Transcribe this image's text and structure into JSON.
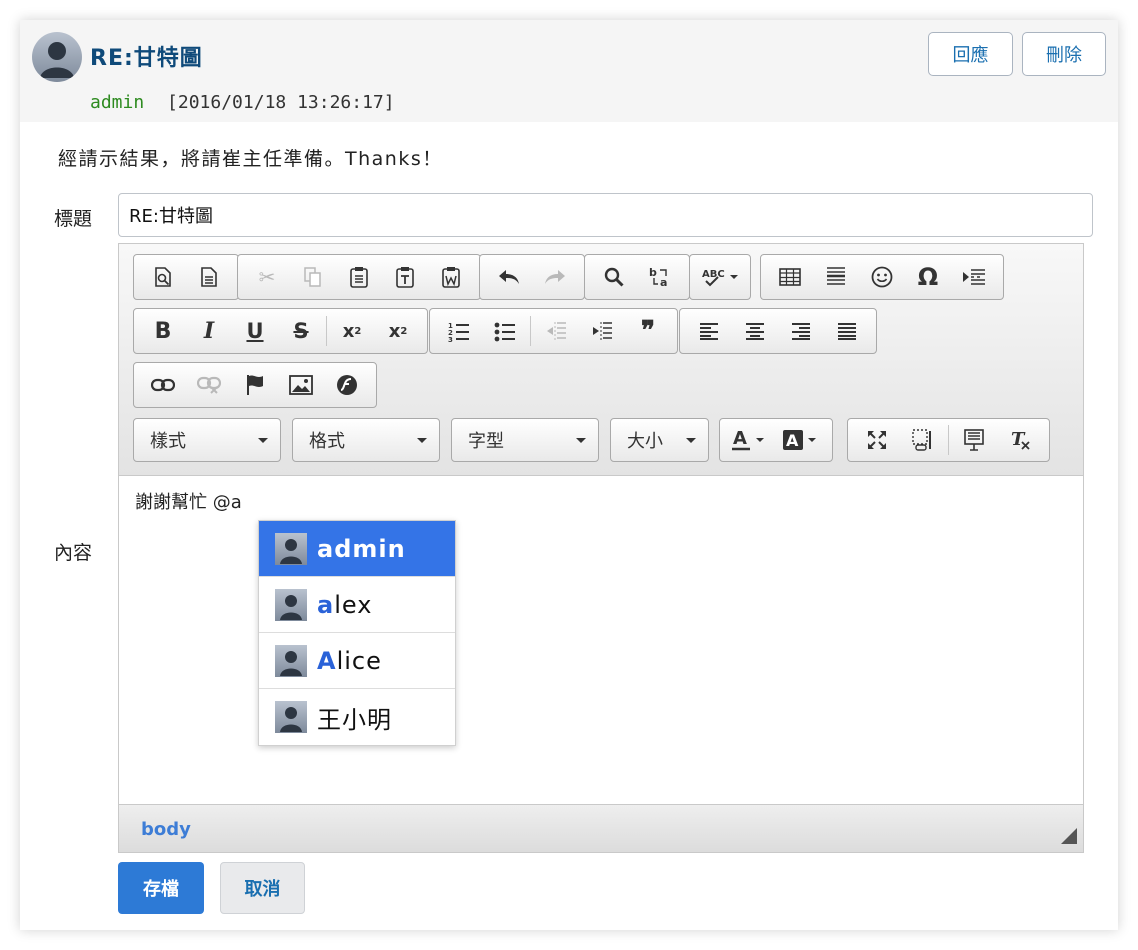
{
  "post": {
    "title": "RE:甘特圖",
    "author": "admin",
    "date": "[2016/01/18 13:26:17]",
    "body": "經請示結果，將請崔主任準備。Thanks！",
    "reply_label": "回應",
    "delete_label": "刪除"
  },
  "form": {
    "title_label": "標題",
    "title_value": "RE:甘特圖",
    "content_label": "內容",
    "content_text": "謝謝幫忙 @a",
    "save_label": "存檔",
    "cancel_label": "取消"
  },
  "toolbar": {
    "style_combo": "樣式",
    "format_combo": "格式",
    "font_combo": "字型",
    "size_combo": "大小"
  },
  "mention": {
    "items": [
      {
        "highlight": "a",
        "rest": "dmin",
        "active": true
      },
      {
        "highlight": "a",
        "rest": "lex",
        "active": false
      },
      {
        "highlight": "A",
        "rest": "lice",
        "active": false
      },
      {
        "highlight": "",
        "rest": "王小明",
        "active": false
      }
    ]
  },
  "footer": {
    "path": "body"
  },
  "colors": {
    "accent": "#2d7ad6",
    "mention_active": "#3474e7",
    "title_color": "#0f4a7a",
    "author_color": "#2e8b20"
  }
}
